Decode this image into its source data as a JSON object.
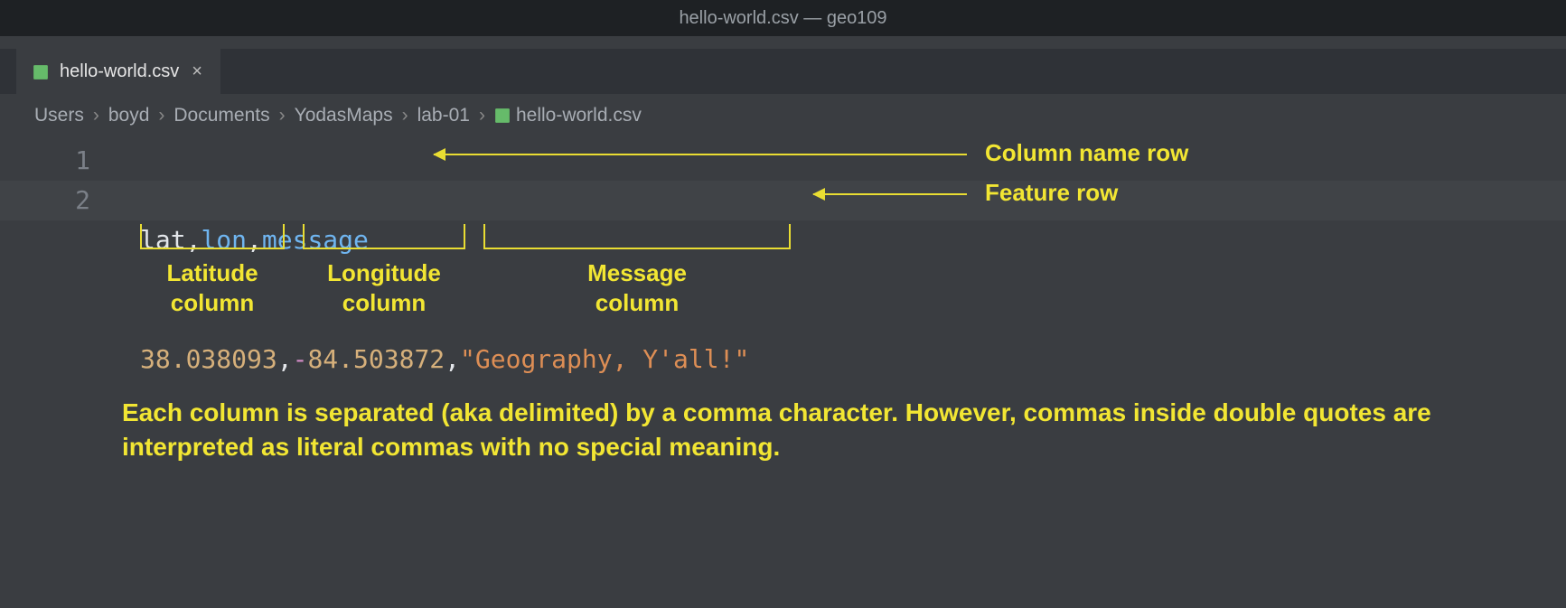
{
  "window": {
    "title": "hello-world.csv — geo109"
  },
  "tab": {
    "filename": "hello-world.csv",
    "close_glyph": "×"
  },
  "breadcrumb": {
    "segments": [
      "Users",
      "boyd",
      "Documents",
      "YodasMaps",
      "lab-01"
    ],
    "filename": "hello-world.csv",
    "separator": "›"
  },
  "editor": {
    "line_numbers": [
      "1",
      "2"
    ],
    "line1": {
      "t0": "lat",
      "t1": ",",
      "t2": "lon",
      "t3": ",",
      "t4": "message"
    },
    "line2": {
      "t0": "38.038093",
      "t1": ",",
      "t2": "-",
      "t3": "84.503872",
      "t4": ",",
      "t5": "\"Geography, Y'all!\""
    }
  },
  "annotations": {
    "row_header": "Column name row",
    "row_feature": "Feature row",
    "col_lat": "Latitude\ncolumn",
    "col_lon": "Longitude\ncolumn",
    "col_msg": "Message\ncolumn",
    "explanation": "Each column is separated (aka delimited) by a comma character. However, commas inside double quotes are interpreted as literal commas with no special meaning."
  },
  "colors": {
    "accent_yellow": "#f2e633",
    "bg": "#3a3d41",
    "titlebar": "#1e2124"
  }
}
